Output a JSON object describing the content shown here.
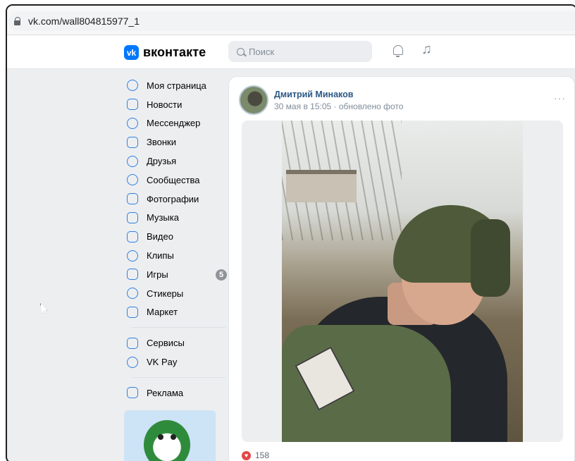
{
  "browser": {
    "url": "vk.com/wall804815977_1"
  },
  "header": {
    "logo_mark": "vk",
    "logo_text": "вконтакте",
    "search_placeholder": "Поиск",
    "icons": [
      "bell-icon",
      "music-icon"
    ]
  },
  "sidebar": {
    "items": [
      {
        "label": "Моя страница",
        "icon": "profile-icon"
      },
      {
        "label": "Новости",
        "icon": "news-icon"
      },
      {
        "label": "Мессенджер",
        "icon": "messenger-icon"
      },
      {
        "label": "Звонки",
        "icon": "phone-icon"
      },
      {
        "label": "Друзья",
        "icon": "friends-icon"
      },
      {
        "label": "Сообщества",
        "icon": "communities-icon"
      },
      {
        "label": "Фотографии",
        "icon": "photos-icon"
      },
      {
        "label": "Музыка",
        "icon": "music-icon"
      },
      {
        "label": "Видео",
        "icon": "video-icon"
      },
      {
        "label": "Клипы",
        "icon": "clips-icon"
      },
      {
        "label": "Игры",
        "icon": "games-icon",
        "badge": "5"
      },
      {
        "label": "Стикеры",
        "icon": "stickers-icon"
      },
      {
        "label": "Маркет",
        "icon": "market-icon"
      }
    ],
    "items2": [
      {
        "label": "Сервисы",
        "icon": "services-icon"
      },
      {
        "label": "VK Pay",
        "icon": "vkpay-icon"
      }
    ],
    "items3": [
      {
        "label": "Реклама",
        "icon": "ads-icon"
      }
    ]
  },
  "post": {
    "author": "Дмитрий Минаков",
    "meta": "30 мая в 15:05 · обновлено фото",
    "more": "···",
    "likes": "158"
  },
  "colors": {
    "accent": "#2d81e0",
    "link": "#2a5885",
    "like": "#e64646",
    "bg": "#edeef0"
  }
}
